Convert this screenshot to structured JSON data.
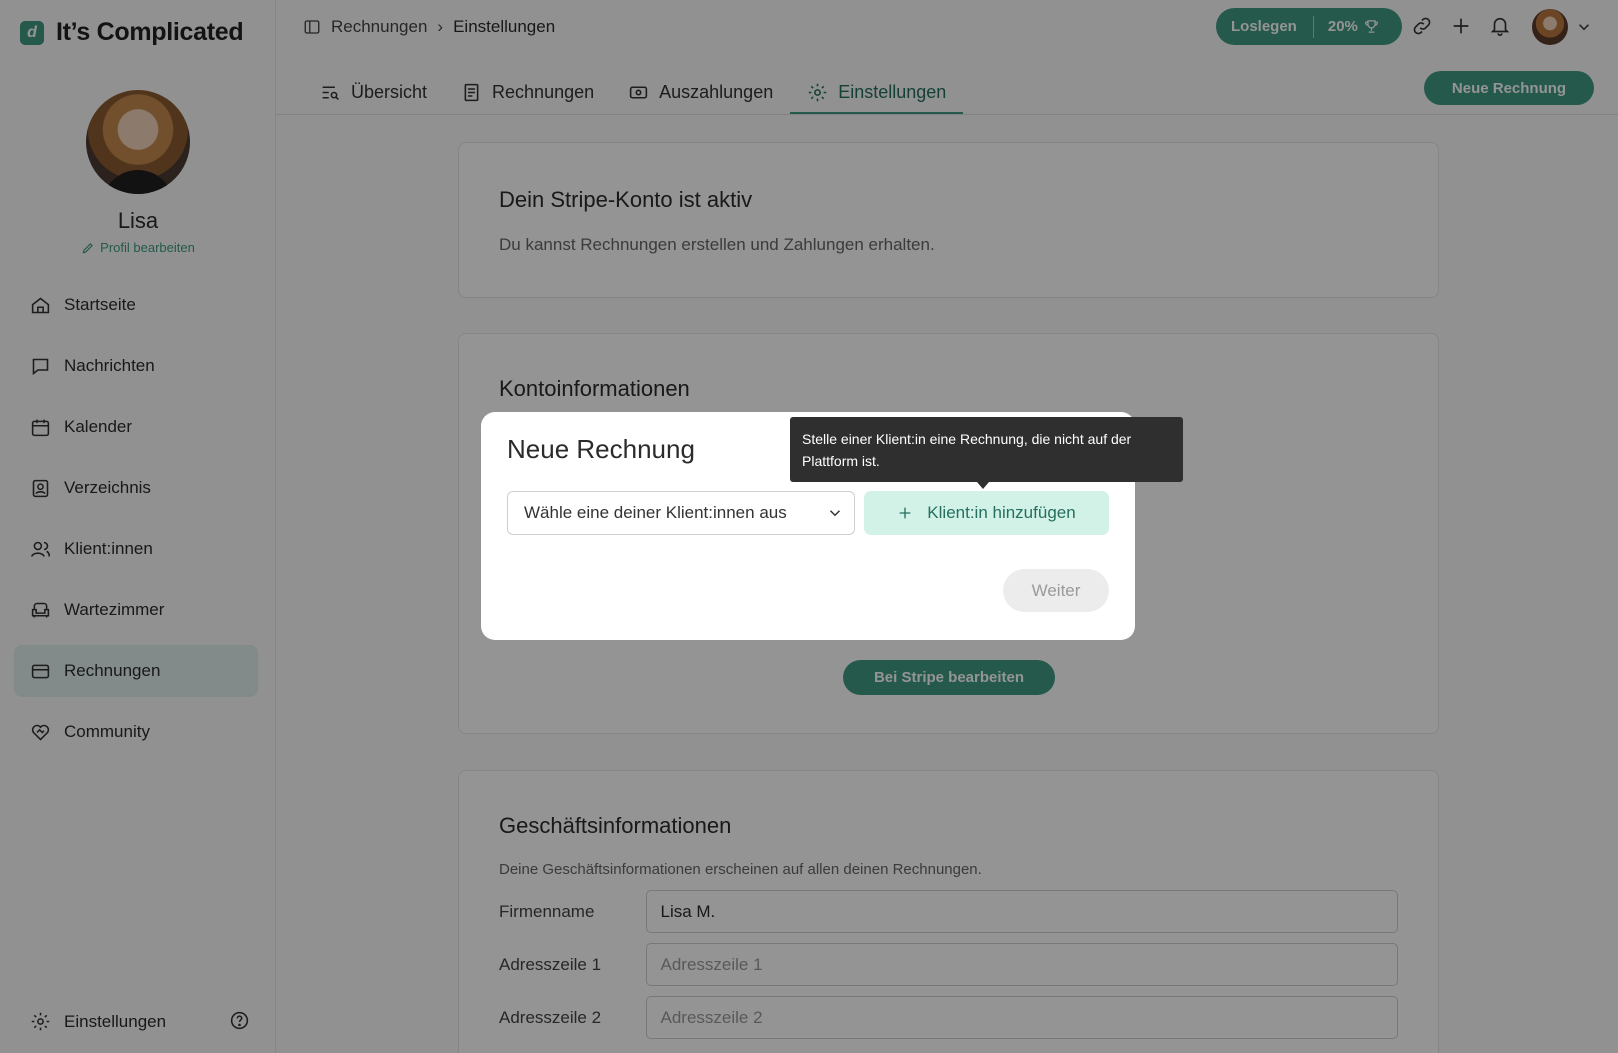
{
  "app": {
    "name": "It’s Complicated",
    "logo_letter": "d",
    "accent": "#3f9a84"
  },
  "profile": {
    "name": "Lisa",
    "edit_label": "Profil bearbeiten"
  },
  "sidebar": {
    "items": [
      {
        "label": "Startseite",
        "icon": "home-icon"
      },
      {
        "label": "Nachrichten",
        "icon": "message-icon"
      },
      {
        "label": "Kalender",
        "icon": "calendar-icon"
      },
      {
        "label": "Verzeichnis",
        "icon": "directory-icon"
      },
      {
        "label": "Klient:innen",
        "icon": "clients-icon"
      },
      {
        "label": "Wartezimmer",
        "icon": "armchair-icon"
      },
      {
        "label": "Rechnungen",
        "icon": "credit-card-icon",
        "active": true
      },
      {
        "label": "Community",
        "icon": "heart-handshake-icon"
      }
    ],
    "bottom_label": "Einstellungen"
  },
  "header": {
    "breadcrumb": {
      "parent": "Rechnungen",
      "current": "Einstellungen"
    },
    "start_label": "Loslegen",
    "progress_label": "20%",
    "new_invoice_label": "Neue Rechnung"
  },
  "tabs": [
    {
      "label": "Übersicht",
      "icon": "overview-icon"
    },
    {
      "label": "Rechnungen",
      "icon": "invoice-icon"
    },
    {
      "label": "Auszahlungen",
      "icon": "money-icon"
    },
    {
      "label": "Einstellungen",
      "icon": "gear-icon",
      "active": true
    }
  ],
  "cards": {
    "stripe": {
      "title": "Dein Stripe-Konto ist aktiv",
      "text": "Du kannst Rechnungen erstellen und Zahlungen erhalten."
    },
    "account": {
      "title": "Kontoinformationen",
      "button": "Bei Stripe bearbeiten"
    },
    "business": {
      "title": "Geschäftsinformationen",
      "text": "Deine Geschäftsinformationen erscheinen auf allen deinen Rechnungen.",
      "fields": [
        {
          "label": "Firmenname",
          "value": "Lisa M.",
          "placeholder": ""
        },
        {
          "label": "Adresszeile 1",
          "value": "",
          "placeholder": "Adresszeile 1"
        },
        {
          "label": "Adresszeile 2",
          "value": "",
          "placeholder": "Adresszeile 2"
        }
      ]
    }
  },
  "modal": {
    "title": "Neue Rechnung",
    "select_placeholder": "Wähle eine deiner Klient:innen aus",
    "add_client_label": "Klient:in hinzufügen",
    "next_label": "Weiter",
    "tooltip": "Stelle einer Klient:in eine Rechnung, die nicht auf der Plattform ist."
  }
}
